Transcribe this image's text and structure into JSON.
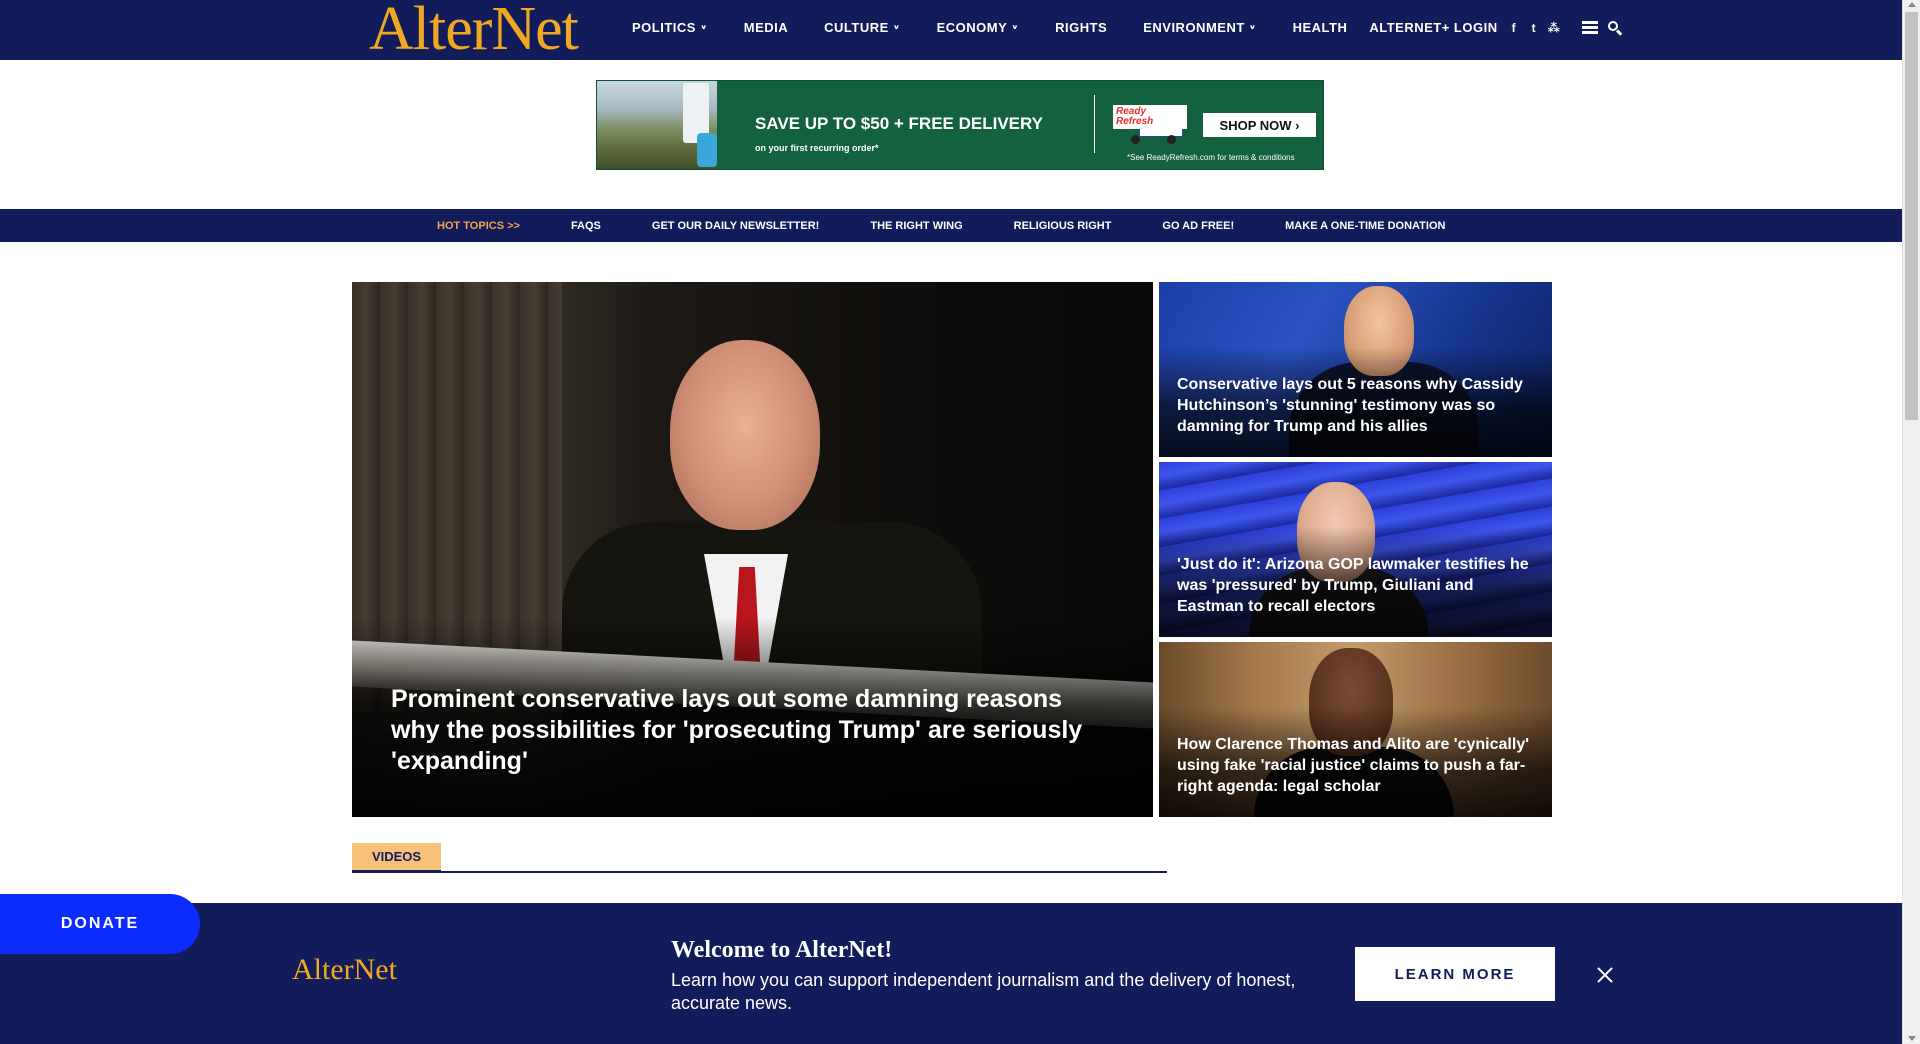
{
  "site": {
    "logo": "AlterNet"
  },
  "nav": {
    "items": [
      {
        "label": "POLITICS",
        "dropdown": true
      },
      {
        "label": "MEDIA",
        "dropdown": false
      },
      {
        "label": "CULTURE",
        "dropdown": true
      },
      {
        "label": "ECONOMY",
        "dropdown": true
      },
      {
        "label": "RIGHTS",
        "dropdown": false
      },
      {
        "label": "ENVIRONMENT",
        "dropdown": true
      },
      {
        "label": "HEALTH",
        "dropdown": false
      }
    ],
    "login_label": "ALTERNET+ LOGIN",
    "social": {
      "facebook": "f",
      "twitter": "t",
      "rss": "⁂"
    },
    "chevron": "∨"
  },
  "ad": {
    "headline": "SAVE UP TO $50 + FREE DELIVERY",
    "subline": "on your first recurring order*",
    "brand": "Ready Refresh",
    "cta": "SHOP NOW ›",
    "terms": "*See ReadyRefresh.com for terms & conditions"
  },
  "subnav": {
    "items": [
      {
        "label": "HOT TOPICS >>",
        "hot": true
      },
      {
        "label": "FAQS",
        "hot": false
      },
      {
        "label": "GET OUR DAILY NEWSLETTER!",
        "hot": false
      },
      {
        "label": "THE RIGHT WING",
        "hot": false
      },
      {
        "label": "RELIGIOUS RIGHT",
        "hot": false
      },
      {
        "label": "GO AD FREE!",
        "hot": false
      },
      {
        "label": "MAKE A ONE-TIME DONATION",
        "hot": false
      }
    ]
  },
  "main_story": {
    "title": "Prominent conservative lays out some damning reasons why the possibilities for 'prosecuting Trump' are seriously 'expanding'"
  },
  "side_stories": [
    {
      "title": "Conservative lays out 5 reasons why Cassidy Hutchinson’s 'stunning' testimony was so damning for Trump and his allies"
    },
    {
      "title": "'Just do it': Arizona GOP lawmaker testifies he was 'pressured' by Trump, Giuliani and Eastman to recall electors"
    },
    {
      "title": "How Clarence Thomas and Alito are 'cynically' using fake 'racial justice' claims to push a far-right agenda: legal scholar"
    }
  ],
  "videos": {
    "label": "VIDEOS"
  },
  "welcome": {
    "logo": "AlterNet",
    "title": "Welcome to AlterNet!",
    "text": "Learn how you can support independent journalism and the delivery of honest, accurate news.",
    "button": "LEARN MORE"
  },
  "donate": {
    "label": "DONATE"
  },
  "colors": {
    "navy": "#121c5b",
    "gold": "#f0a823",
    "donate_blue": "#0b2bff",
    "ad_green": "#14613f",
    "hot_topics": "#f2a54a"
  }
}
